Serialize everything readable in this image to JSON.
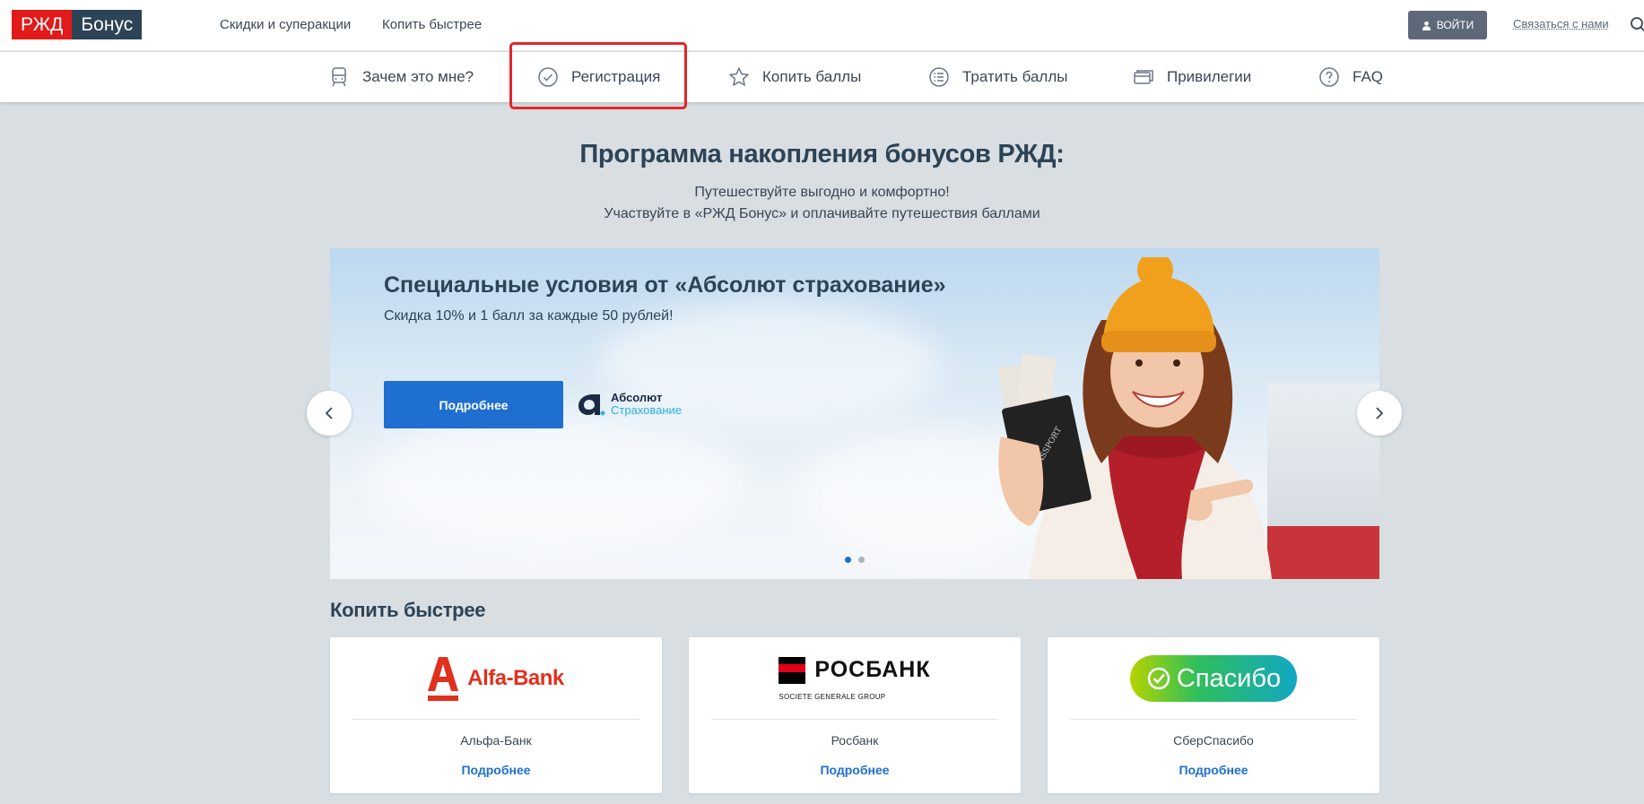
{
  "brand": {
    "part1": "РЖД",
    "part2": "Бонус"
  },
  "top_nav": {
    "links": [
      "Скидки и суперакции",
      "Копить быстрее"
    ],
    "login_label": "ВОЙТИ",
    "contact_label": "Связаться с нами"
  },
  "main_nav": {
    "items": [
      {
        "label": "Зачем это мне?",
        "icon": "train-icon"
      },
      {
        "label": "Регистрация",
        "icon": "check-circle-icon"
      },
      {
        "label": "Копить баллы",
        "icon": "star-icon"
      },
      {
        "label": "Тратить баллы",
        "icon": "list-icon"
      },
      {
        "label": "Привилегии",
        "icon": "cards-icon"
      },
      {
        "label": "FAQ",
        "icon": "question-icon"
      }
    ]
  },
  "hero": {
    "title": "Программа накопления бонусов РЖД:",
    "line1": "Путешествуйте выгодно и комфортно!",
    "line2": "Участвуйте в «РЖД Бонус» и оплачивайте путешествия баллами"
  },
  "banner": {
    "title": "Специальные условия от «Абсолют страхование»",
    "subtitle": "Скидка 10% и 1 балл за каждые 50 рублей!",
    "button_label": "Подробнее",
    "partner_name1": "Абсолют",
    "partner_name2": "Страхование",
    "slides_total": 2,
    "active_slide": 1
  },
  "earn_faster": {
    "title": "Копить быстрее",
    "partners": [
      {
        "logo_text": "Alfa-Bank",
        "name": "Альфа-Банк",
        "link": "Подробнее"
      },
      {
        "logo_text": "РОСБАНК",
        "logo_sub": "SOCIETE GENERALE GROUP",
        "name": "Росбанк",
        "link": "Подробнее"
      },
      {
        "logo_text": "Спасибо",
        "name": "СберСпасибо",
        "link": "Подробнее"
      }
    ]
  },
  "colors": {
    "brand_red": "#e21a1a",
    "brand_dark": "#2d4356",
    "accent_blue": "#1e6fcf",
    "highlight_red": "#e0262a",
    "page_bg": "#d8dee2"
  }
}
